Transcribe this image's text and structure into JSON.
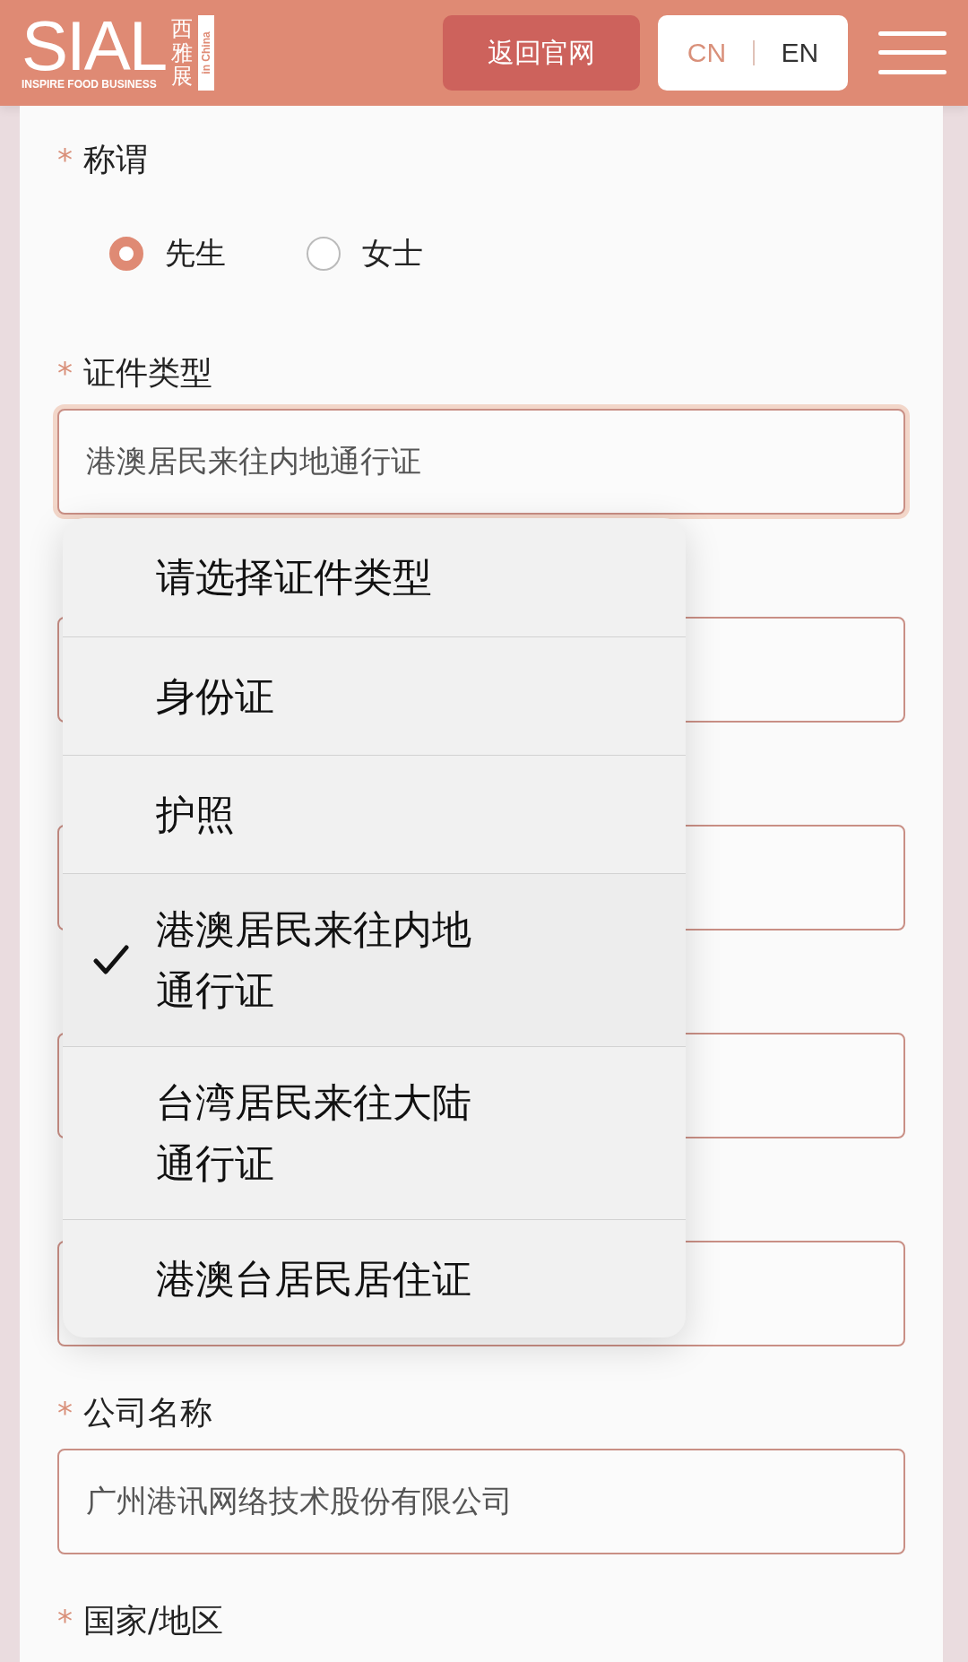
{
  "header": {
    "logo": {
      "wordmark": "SIAL",
      "tagline": "INSPIRE FOOD BUSINESS",
      "chinese": "西雅展",
      "badge": "in China"
    },
    "back_button": "返回官网",
    "languages": [
      {
        "label": "CN",
        "selected": true
      },
      {
        "label": "EN",
        "selected": false
      }
    ]
  },
  "fields": [
    {
      "kind": "radio",
      "mark": "*",
      "label": "称谓",
      "options": [
        {
          "label": "先生",
          "selected": true
        },
        {
          "label": "女士",
          "selected": false
        }
      ]
    },
    {
      "kind": "select",
      "mark": "*",
      "label": "证件类型",
      "value": "港澳居民来往内地通行证",
      "focused": true,
      "dropdown": [
        {
          "label": "请选择证件类型",
          "selected": false
        },
        {
          "label": "身份证",
          "selected": false
        },
        {
          "label": "护照",
          "selected": false
        },
        {
          "label": "港澳居民来往内地通行证",
          "selected": true
        },
        {
          "label": "台湾居民来往大陆通行证",
          "selected": false
        },
        {
          "label": "港澳台居民居住证",
          "selected": false
        }
      ]
    },
    {
      "kind": "text"
    },
    {
      "kind": "text"
    },
    {
      "kind": "text"
    },
    {
      "kind": "text"
    },
    {
      "kind": "text",
      "mark": "*",
      "label": "公司名称",
      "value": "广州港讯网络技术股份有限公司"
    },
    {
      "kind": "heading",
      "mark": "*",
      "label": "国家/地区"
    }
  ]
}
